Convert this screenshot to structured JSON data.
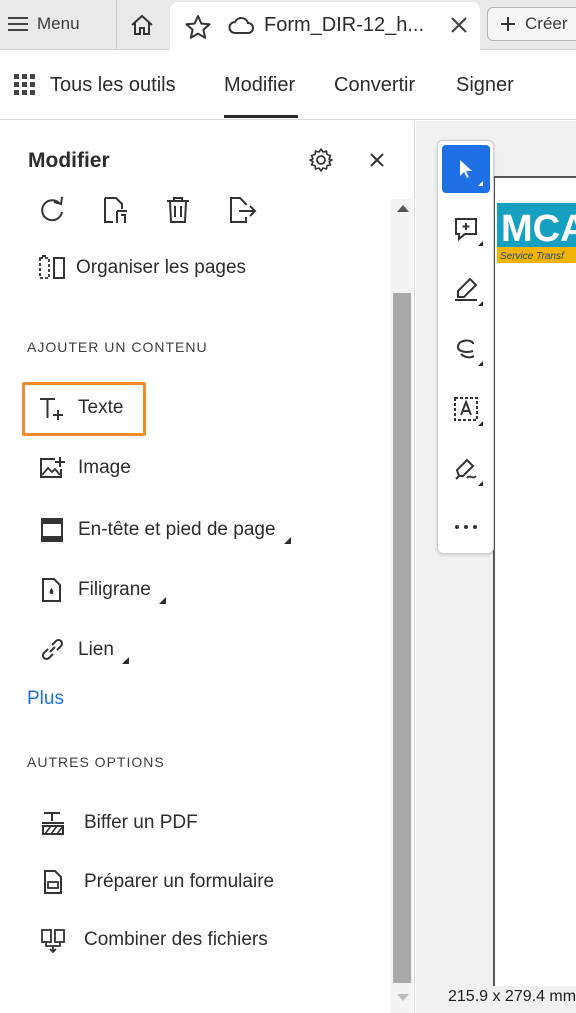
{
  "tabbar": {
    "menu_label": "Menu",
    "doc_tab_title": "Form_DIR-12_h...",
    "create_label": "Créer"
  },
  "toolbar": {
    "all_tools": "Tous les outils",
    "modify": "Modifier",
    "convert": "Convertir",
    "sign": "Signer"
  },
  "panel": {
    "title": "Modifier",
    "organize_label": "Organiser les pages",
    "add_content_heading": "AJOUTER UN CONTENU",
    "add_items": [
      {
        "label": "Texte"
      },
      {
        "label": "Image"
      },
      {
        "label": "En-tête et pied de page"
      },
      {
        "label": "Filigrane"
      },
      {
        "label": "Lien"
      }
    ],
    "more_label": "Plus",
    "other_options_heading": "AUTRES OPTIONS",
    "other_items": [
      {
        "label": "Biffer un PDF"
      },
      {
        "label": "Préparer un formulaire"
      },
      {
        "label": "Combiner des fichiers"
      }
    ]
  },
  "document": {
    "page_size": "215.9 x 279.4 mm",
    "logo_text": "MCA",
    "logo_subtext": "Service Transf"
  },
  "colors": {
    "accent_blue": "#1f6fe5",
    "highlight_orange": "#f28a2e",
    "link_blue": "#1d6fd8"
  }
}
